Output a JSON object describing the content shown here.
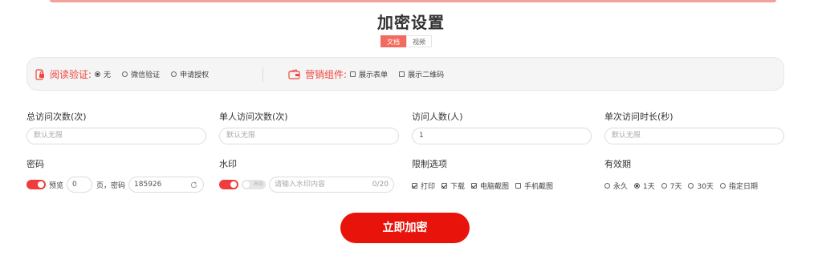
{
  "title": "加密设置",
  "tabs": [
    {
      "label": "文档",
      "active": true
    },
    {
      "label": "视频",
      "active": false
    }
  ],
  "settings_bar": {
    "read_verify": {
      "label": "阅读验证:",
      "icon": "phone-lock-icon",
      "options": [
        {
          "label": "无",
          "selected": true
        },
        {
          "label": "微信验证",
          "selected": false
        },
        {
          "label": "申请授权",
          "selected": false
        }
      ]
    },
    "marketing": {
      "label": "营销组件:",
      "icon": "wallet-icon",
      "options": [
        {
          "label": "展示表单",
          "checked": false
        },
        {
          "label": "展示二维码",
          "checked": false
        }
      ]
    }
  },
  "fields": {
    "total_visits": {
      "label": "总访问次数(次)",
      "placeholder": "默认无限"
    },
    "single_visits": {
      "label": "单人访问次数(次)",
      "placeholder": "默认无限"
    },
    "visitors": {
      "label": "访问人数(人)",
      "value": "1"
    },
    "single_duration": {
      "label": "单次访问时长(秒)",
      "placeholder": "默认无限"
    }
  },
  "password": {
    "label": "密码",
    "enabled": true,
    "preview_label": "预览",
    "preview_pages": "0",
    "pages_suffix": "页，密码",
    "password_value": "185926"
  },
  "watermark": {
    "label": "水印",
    "enabled": true,
    "secondary_toggle": "高级",
    "placeholder": "请输入水印内容",
    "counter": "0/20"
  },
  "restrictions": {
    "label": "限制选项",
    "options": [
      {
        "label": "打印",
        "checked": true
      },
      {
        "label": "下载",
        "checked": true
      },
      {
        "label": "电脑截图",
        "checked": true
      },
      {
        "label": "手机截图",
        "checked": false
      }
    ]
  },
  "validity": {
    "label": "有效期",
    "options": [
      {
        "label": "永久",
        "selected": false
      },
      {
        "label": "1天",
        "selected": true
      },
      {
        "label": "7天",
        "selected": false
      },
      {
        "label": "30天",
        "selected": false
      },
      {
        "label": "指定日期",
        "selected": false
      }
    ]
  },
  "submit_label": "立即加密",
  "colors": {
    "accent": "#e8130a",
    "label_red": "#f0463c",
    "tab_active": "#f26b5e"
  }
}
